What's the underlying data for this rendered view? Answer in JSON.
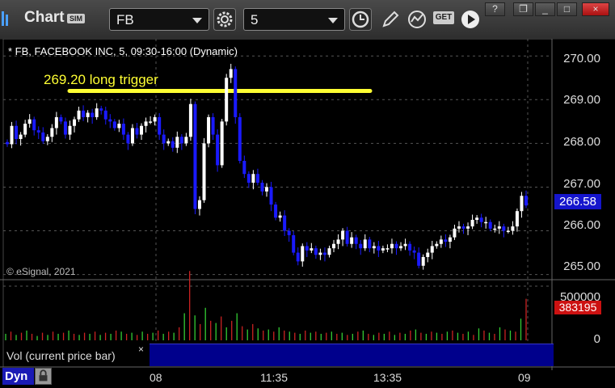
{
  "toolbar": {
    "title": "Chart",
    "badge": "SIM",
    "symbol_value": "FB",
    "interval_value": "5",
    "get_button": "GET",
    "window_buttons": [
      "?",
      "❐",
      "_",
      "□",
      "×"
    ],
    "icons": [
      "chart-logo-icon",
      "symbol-dropdown-icon",
      "settings-gear-icon",
      "interval-dropdown-icon",
      "clock-icon",
      "pencil-draw-icon",
      "study-icon",
      "get-data-icon",
      "play-icon"
    ]
  },
  "chart": {
    "legend": "* FB, FACEBOOK INC, 5, 09:30-16:00 (Dynamic)",
    "annotation": "269.20 long trigger",
    "annotation_line_value": 269.2,
    "copyright": "© eSignal, 2021",
    "price_labels": [
      "270.00",
      "269.00",
      "268.00",
      "267.00",
      "266.00",
      "265.00"
    ],
    "last_price": "266.58",
    "volume_labels": [
      "500000",
      "0"
    ],
    "volume_last": "383195",
    "volume_panel_label": "Vol (current price bar)",
    "volume_close": "×",
    "time_labels": [
      "08",
      "11:35",
      "13:35",
      "09"
    ],
    "dyn_label": "Dyn",
    "colors": {
      "up_candle": "#ffffff",
      "down_candle": "#1a1aff",
      "annotation": "#ffff33",
      "volume_up": "#33cc33",
      "volume_down": "#cc2222",
      "grid": "#555555"
    }
  },
  "chart_data": {
    "type": "candlestick",
    "title": "* FB, FACEBOOK INC, 5, 09:30-16:00 (Dynamic)",
    "y_range": [
      264.9,
      270.3
    ],
    "y_ticks": [
      265,
      266,
      267,
      268,
      269,
      270
    ],
    "x_ticks": [
      "08",
      "11:35",
      "13:35",
      "09"
    ],
    "last_price": 266.58,
    "annotation": {
      "text": "269.20 long trigger",
      "value": 269.2
    },
    "candles_close": [
      267.98,
      268.4,
      268.1,
      268.2,
      268.45,
      268.55,
      268.3,
      268.25,
      268.05,
      268.15,
      268.35,
      268.6,
      268.5,
      268.2,
      268.4,
      268.55,
      268.75,
      268.6,
      268.7,
      268.6,
      268.8,
      268.75,
      268.55,
      268.5,
      268.35,
      268.45,
      268.2,
      268.0,
      268.35,
      268.2,
      268.4,
      268.5,
      268.5,
      268.6,
      268.2,
      268.0,
      268.05,
      267.9,
      268.15,
      268.0,
      268.15,
      268.9,
      266.5,
      266.7,
      268.0,
      268.6,
      268.2,
      267.5,
      268.5,
      269.5,
      269.7,
      268.6,
      267.6,
      267.3,
      267.1,
      267.3,
      267.1,
      266.9,
      267.0,
      266.6,
      266.3,
      266.35,
      266.0,
      265.9,
      265.5,
      265.3,
      265.65,
      265.55,
      265.6,
      265.45,
      265.5,
      265.45,
      265.6,
      265.7,
      265.8,
      266.0,
      265.7,
      265.85,
      265.7,
      265.6,
      265.8,
      265.6,
      265.65,
      265.55,
      265.6,
      265.6,
      265.7,
      265.6,
      265.65,
      265.7,
      265.55,
      265.5,
      265.2,
      265.4,
      265.5,
      265.65,
      265.7,
      265.8,
      265.75,
      265.85,
      266.05,
      266.1,
      266.05,
      266.1,
      266.25,
      266.3,
      266.2,
      266.2,
      266.05,
      266.05,
      266.1,
      266.0,
      266.0,
      266.1,
      266.45,
      266.8,
      266.58
    ]
  },
  "volume_data": {
    "y_range": [
      0,
      500000
    ],
    "last_volume": 383195,
    "values": [
      60000,
      80000,
      50000,
      70000,
      90000,
      60000,
      40000,
      70000,
      50000,
      80000,
      60000,
      70000,
      90000,
      60000,
      50000,
      70000,
      60000,
      80000,
      50000,
      70000,
      60000,
      90000,
      80000,
      60000,
      70000,
      50000,
      80000,
      60000,
      70000,
      90000,
      60000,
      80000,
      70000,
      120000,
      250000,
      640000,
      230000,
      150000,
      300000,
      180000,
      160000,
      220000,
      120000,
      180000,
      250000,
      130000,
      100000,
      150000,
      110000,
      90000,
      100000,
      80000,
      120000,
      90000,
      80000,
      70000,
      60000,
      90000,
      70000,
      80000,
      60000,
      70000,
      80000,
      60000,
      70000,
      50000,
      60000,
      80000,
      90000,
      60000,
      50000,
      70000,
      60000,
      80000,
      50000,
      70000,
      60000,
      90000,
      100000,
      70000,
      60000,
      80000,
      70000,
      60000,
      80000,
      90000,
      70000,
      60000,
      80000,
      50000,
      110000,
      90000,
      70000,
      60000,
      120000,
      100000,
      90000,
      80000,
      200000,
      383195
    ]
  }
}
